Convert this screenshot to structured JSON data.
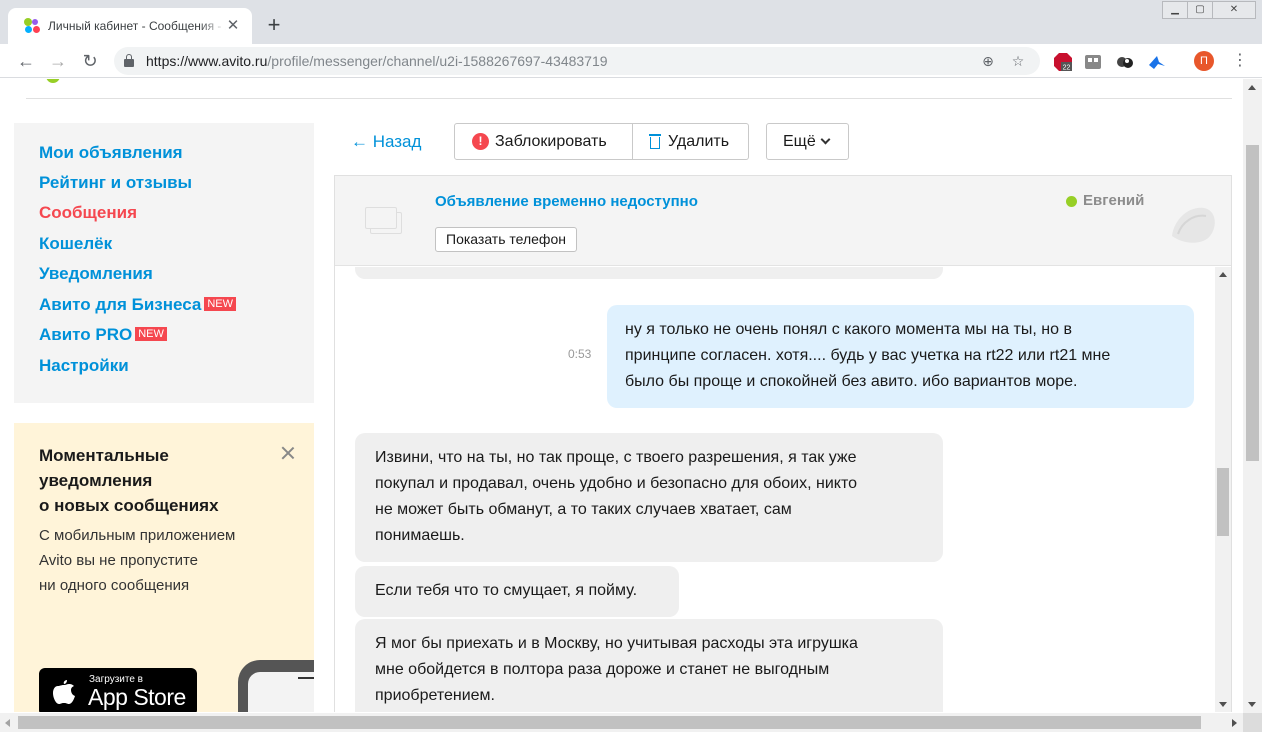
{
  "browser": {
    "tab_title": "Личный кабинет - Сообщения - Ави",
    "new_tab": "+",
    "tab_close": "✕",
    "window_buttons": {
      "minimize": "▁",
      "maximize": "▢",
      "close": "✕"
    },
    "url_host": "https://www.avito.ru",
    "url_path": "/profile/messenger/channel/u2i-1588267697-43483719",
    "profile_letter": "П",
    "ext_badge": "22"
  },
  "sidebar": {
    "items": [
      {
        "label": "Мои объявления"
      },
      {
        "label": "Рейтинг и отзывы"
      },
      {
        "label": "Сообщения",
        "active": true
      },
      {
        "label": "Кошелёк"
      },
      {
        "label": "Уведомления"
      },
      {
        "label": "Авито для Бизнеса",
        "badge": "NEW"
      },
      {
        "label": "Авито PRO",
        "badge": "NEW"
      },
      {
        "label": "Настройки"
      }
    ]
  },
  "promo": {
    "title": "Моментальные\nуведомления\nо новых сообщениях",
    "text": "С мобильным приложением\nAvito вы не пропустите\nни одного сообщения",
    "appstore_small": "Загрузите в",
    "appstore_big": "App Store"
  },
  "actions": {
    "back": "← Назад",
    "block": "Заблокировать",
    "delete": "Удалить",
    "more": "Ещё"
  },
  "chat": {
    "ad_title": "Объявление временно недоступно",
    "show_phone": "Показать телефон",
    "user_name": "Евгений",
    "messages": [
      {
        "dir": "out",
        "time": "0:53",
        "lines": [
          "ну я только не очень понял с какого момента мы на ты, но в",
          "принципе согласен. хотя.... будь у вас учетка на rt22 или rt21 мне",
          "было бы проще и спокойней без авито. ибо вариантов море."
        ]
      },
      {
        "dir": "in",
        "lines": [
          "Извини, что на ты, но так проще, с твоего разрешения, я так уже",
          "покупал и продавал, очень удобно и безопасно для обоих, никто",
          "не может быть обманут, а то таких случаев хватает, сам",
          "понимаешь."
        ]
      },
      {
        "dir": "in",
        "lines": [
          "Если тебя что то смущает, я пойму."
        ]
      },
      {
        "dir": "in",
        "lines": [
          "Я мог бы приехать и в Москву, но учитывая расходы эта игрушка",
          "мне обойдется в полтора раза дороже и станет не выгодным",
          "приобретением."
        ]
      }
    ]
  },
  "colors": {
    "link": "#0091d9",
    "active": "#f5474f",
    "online": "#97cf26",
    "bubble_in": "#efefef",
    "bubble_out": "#dff1fe",
    "promo_bg": "#fff4d9"
  }
}
